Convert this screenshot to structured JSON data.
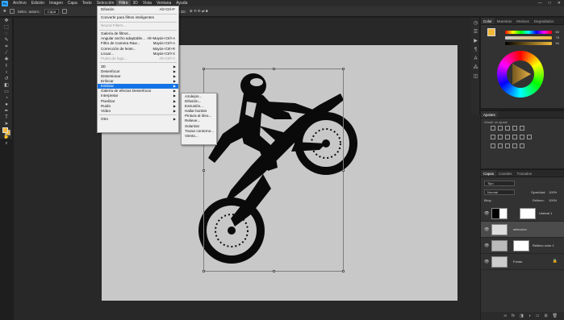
{
  "menubar": {
    "logo": "Ps",
    "items": [
      "Archivo",
      "Edición",
      "Imagen",
      "Capa",
      "Texto",
      "Selección",
      "Filtro",
      "3D",
      "Vista",
      "Ventana",
      "Ayuda"
    ],
    "active_index": 6,
    "window_controls": [
      "—",
      "□",
      "✕"
    ]
  },
  "options_bar": {
    "feather_checkbox_label": "Selec. autom.:",
    "target_select": "Capa",
    "mode_3d": "Modo 3D:"
  },
  "filter_menu": {
    "items": [
      {
        "label": "Difusión",
        "shortcut": "Alt+Ctrl+F"
      },
      {
        "sep": true
      },
      {
        "label": "Convertir para filtros inteligentes"
      },
      {
        "sep": true
      },
      {
        "label": "Neural Filters...",
        "disabled": true
      },
      {
        "sep": true
      },
      {
        "label": "Galería de filtros..."
      },
      {
        "label": "Angular ancho adaptable...",
        "shortcut": "Alt+Mayús+Ctrl+A"
      },
      {
        "label": "Filtro de Camera Raw...",
        "shortcut": "Mayús+Ctrl+A"
      },
      {
        "label": "Corrección de lente...",
        "shortcut": "Mayús+Ctrl+R"
      },
      {
        "label": "Licuar...",
        "shortcut": "Mayús+Ctrl+X"
      },
      {
        "label": "Punto de fuga...",
        "shortcut": "Alt+Ctrl+V",
        "disabled": true
      },
      {
        "sep": true
      },
      {
        "label": "3D",
        "submenu": true
      },
      {
        "label": "Desenfocar",
        "submenu": true
      },
      {
        "label": "Distorsionar",
        "submenu": true
      },
      {
        "label": "Enfocar",
        "submenu": true
      },
      {
        "label": "Estilizar",
        "submenu": true,
        "highlighted": true
      },
      {
        "label": "Galería de efectos Desenfocar",
        "submenu": true
      },
      {
        "label": "Interpretar",
        "submenu": true
      },
      {
        "label": "Pixelizar",
        "submenu": true
      },
      {
        "label": "Ruido",
        "submenu": true
      },
      {
        "label": "Vídeo",
        "submenu": true
      },
      {
        "sep": true
      },
      {
        "label": "Otro",
        "submenu": true
      }
    ]
  },
  "stylize_submenu": {
    "items": [
      "Azulejos...",
      "Difusión...",
      "Extrusión...",
      "Hallar bordes",
      "Pintura al óleo...",
      "Relieve...",
      "Solarizar",
      "Trazar contorno...",
      "Viento..."
    ]
  },
  "color_panel": {
    "tabs": [
      "Color",
      "Muestras",
      "Motivos",
      "Degradados"
    ],
    "values": [
      "60",
      "75",
      "94"
    ]
  },
  "adjust_panel": {
    "tabs": [
      "Ajustes"
    ],
    "subtitle": "Añadir un ajuste"
  },
  "layers_panel": {
    "tabs": [
      "Capas",
      "Canales",
      "Trazados"
    ],
    "kind_filter": "Tipo",
    "blend_mode": "Normal",
    "opacity_label": "Opacidad:",
    "opacity_value": "100%",
    "lock_label": "Bloq.:",
    "fill_label": "Relleno:",
    "fill_value": "100%",
    "layers": [
      {
        "name": "Umbral 1",
        "selected": false
      },
      {
        "name": "selección",
        "selected": true
      },
      {
        "name": "Relleno color 1",
        "selected": false
      },
      {
        "name": "Fondo",
        "selected": false
      }
    ]
  },
  "colors": {
    "foreground": "#f0b83a",
    "menu_highlight": "#1473e6",
    "ps_blue": "#31a8ff"
  }
}
